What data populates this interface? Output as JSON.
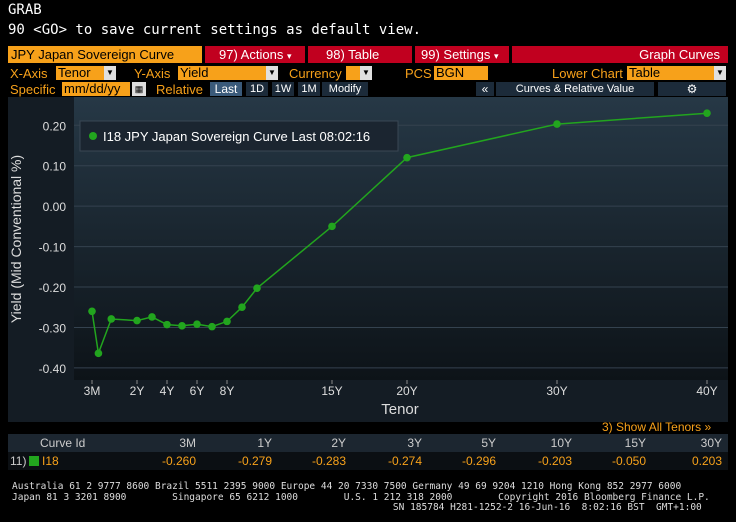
{
  "header": {
    "grab": "GRAB",
    "hint": "90 <GO> to save current settings as default view."
  },
  "toolbar": {
    "title": "JPY Japan Sovereign Curve",
    "actions": "97) Actions",
    "table": "98) Table",
    "settings": "99) Settings",
    "graph_curves": "Graph Curves"
  },
  "axis_bar": {
    "xaxis_label": "X-Axis",
    "xaxis_value": "Tenor",
    "yaxis_label": "Y-Axis",
    "yaxis_value": "Yield",
    "currency_label": "Currency",
    "currency_value": "",
    "pcs_label": "PCS",
    "pcs_value": "BGN",
    "lower_chart_label": "Lower Chart",
    "lower_chart_value": "Table"
  },
  "specific_bar": {
    "specific_label": "Specific",
    "date_placeholder": "mm/dd/yy",
    "relative_label": "Relative",
    "buttons": [
      "Last",
      "1D",
      "1W",
      "1M",
      "Modify"
    ],
    "collapse": "«",
    "curves_panel": "Curves & Relative Value",
    "gear": "⚙"
  },
  "chart_data": {
    "type": "line",
    "title": "",
    "xlabel": "Tenor",
    "ylabel": "Yield (Mid Conventional %)",
    "ylim": [
      -0.43,
      0.27
    ],
    "yticks": [
      0.2,
      0.1,
      0.0,
      -0.1,
      -0.2,
      -0.3,
      -0.4
    ],
    "ytick_labels": [
      "0.20",
      "0.10",
      "0.00",
      "-0.10",
      "-0.20",
      "-0.30",
      "-0.40"
    ],
    "xtick_labels": [
      {
        "label": "3M",
        "years": 0.25
      },
      {
        "label": "2Y",
        "years": 2
      },
      {
        "label": "4Y",
        "years": 4
      },
      {
        "label": "6Y",
        "years": 6
      },
      {
        "label": "8Y",
        "years": 8
      },
      {
        "label": "15Y",
        "years": 15
      },
      {
        "label": "20Y",
        "years": 20
      },
      {
        "label": "30Y",
        "years": 30
      },
      {
        "label": "40Y",
        "years": 40
      }
    ],
    "legend": "I18 JPY Japan Sovereign Curve Last 08:02:16",
    "legend_position": "top-left",
    "color": "#22a51e",
    "series": [
      {
        "name": "I18 JPY Japan Sovereign Curve Last 08:02:16",
        "points": [
          {
            "years": 0.25,
            "y": -0.26
          },
          {
            "years": 0.5,
            "y": -0.364
          },
          {
            "years": 1,
            "y": -0.279
          },
          {
            "years": 2,
            "y": -0.283
          },
          {
            "years": 3,
            "y": -0.274
          },
          {
            "years": 4,
            "y": -0.293
          },
          {
            "years": 5,
            "y": -0.296
          },
          {
            "years": 6,
            "y": -0.292
          },
          {
            "years": 7,
            "y": -0.298
          },
          {
            "years": 8,
            "y": -0.285
          },
          {
            "years": 9,
            "y": -0.25
          },
          {
            "years": 10,
            "y": -0.203
          },
          {
            "years": 15,
            "y": -0.05
          },
          {
            "years": 20,
            "y": 0.12
          },
          {
            "years": 30,
            "y": 0.203
          },
          {
            "years": 40,
            "y": 0.23
          }
        ]
      }
    ]
  },
  "show_all": "3) Show All Tenors »",
  "table": {
    "headers": [
      "Curve Id",
      "3M",
      "1Y",
      "2Y",
      "3Y",
      "5Y",
      "10Y",
      "15Y",
      "30Y"
    ],
    "rows": [
      {
        "index": "11)",
        "id": "I18",
        "values": [
          "-0.260",
          "-0.279",
          "-0.283",
          "-0.274",
          "-0.296",
          "-0.203",
          "-0.050",
          "0.203"
        ]
      }
    ]
  },
  "footer": {
    "line1": "Australia 61 2 9777 8600 Brazil 5511 2395 9000 Europe 44 20 7330 7500 Germany 49 69 9204 1210 Hong Kong 852 2977 6000",
    "line2": "Japan 81 3 3201 8900        Singapore 65 6212 1000        U.S. 1 212 318 2000        Copyright 2016 Bloomberg Finance L.P.",
    "line3": "SN 185784 H281-1252-2 16-Jun-16  8:02:16 BST  GMT+1:00"
  }
}
